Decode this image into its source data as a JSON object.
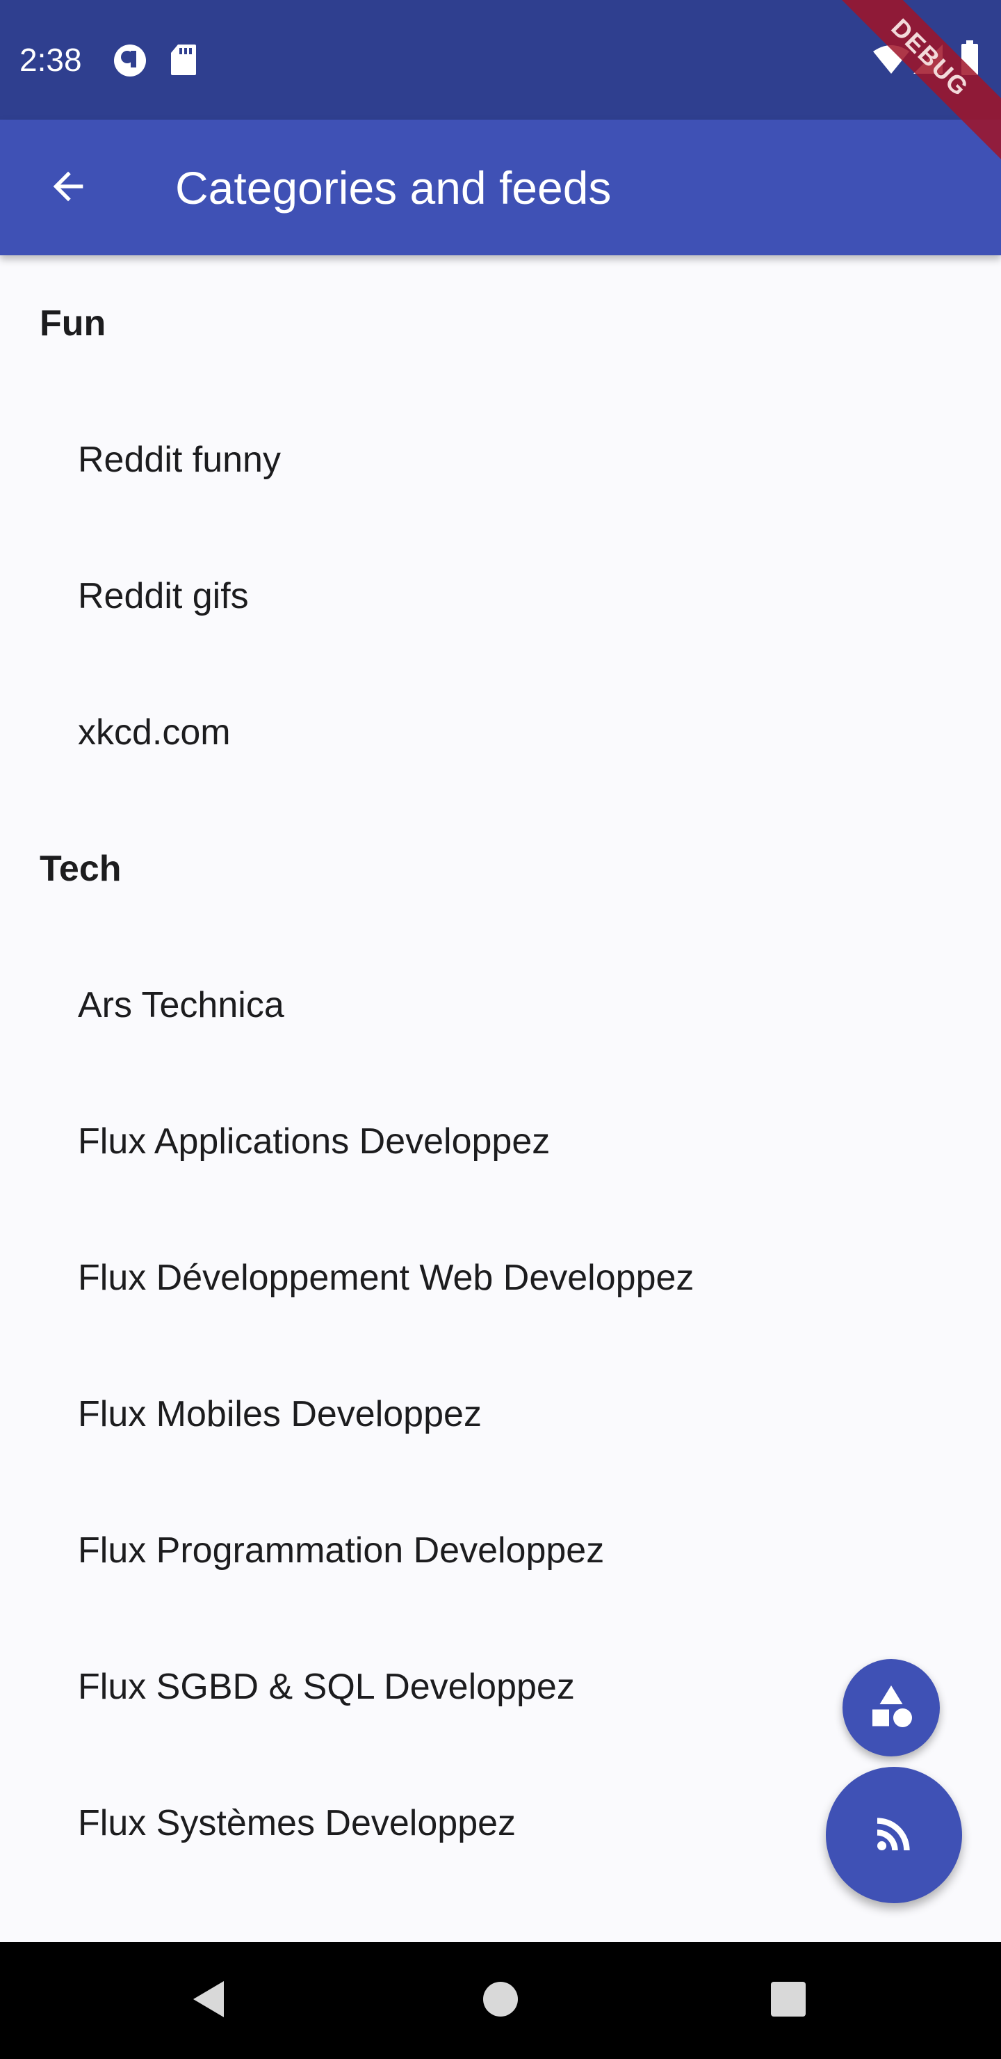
{
  "status_bar": {
    "time": "2:38",
    "left_icons": [
      "record-icon",
      "sd-card-icon"
    ],
    "right_icons": [
      "wifi-icon",
      "signal-icon",
      "battery-icon"
    ]
  },
  "debug_banner": "DEBUG",
  "app_bar": {
    "title": "Categories and feeds",
    "back_icon": "arrow-back-icon"
  },
  "categories": [
    {
      "name": "Fun",
      "feeds": [
        "Reddit funny",
        "Reddit gifs",
        "xkcd.com"
      ]
    },
    {
      "name": "Tech",
      "feeds": [
        "Ars Technica",
        "Flux Applications Developpez",
        "Flux Développement Web Developpez",
        "Flux Mobiles Developpez",
        "Flux Programmation Developpez",
        "Flux SGBD & SQL Developpez",
        "Flux Systèmes Developpez"
      ]
    }
  ],
  "fabs": {
    "add_category_icon": "category-shapes-icon",
    "add_feed_icon": "rss-feed-icon"
  },
  "nav_bar": {
    "icons": [
      "nav-back-icon",
      "nav-home-icon",
      "nav-recents-icon"
    ]
  },
  "colors": {
    "status_bar": "#2f3f8f",
    "app_bar": "#3f51b5",
    "accent": "#3f51b5",
    "background": "#fafafd"
  }
}
